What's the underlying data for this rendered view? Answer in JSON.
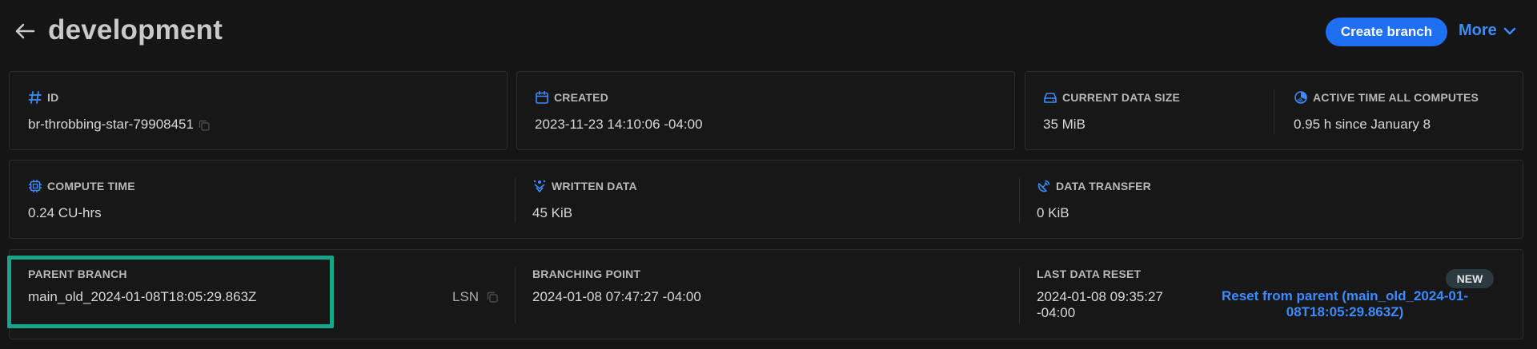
{
  "header": {
    "title": "development",
    "create_label": "Create branch",
    "more_label": "More"
  },
  "row1": {
    "id": {
      "label": "ID",
      "value": "br-throbbing-star-79908451"
    },
    "created": {
      "label": "CREATED",
      "value": "2023-11-23 14:10:06 -04:00"
    },
    "data_size": {
      "label": "CURRENT DATA SIZE",
      "value": "35 MiB"
    },
    "active_time": {
      "label": "ACTIVE TIME ALL COMPUTES",
      "value": "0.95 h since January 8"
    }
  },
  "row2": {
    "compute_time": {
      "label": "COMPUTE TIME",
      "value": "0.24 CU-hrs"
    },
    "written_data": {
      "label": "WRITTEN DATA",
      "value": "45 KiB"
    },
    "data_transfer": {
      "label": "DATA TRANSFER",
      "value": "0 KiB"
    }
  },
  "row3": {
    "parent_branch": {
      "label": "PARENT BRANCH",
      "value": "main_old_2024-01-08T18:05:29.863Z",
      "lsn_label": "LSN"
    },
    "branching_point": {
      "label": "BRANCHING POINT",
      "value": "2024-01-08 07:47:27 -04:00"
    },
    "last_reset": {
      "label": "LAST DATA RESET",
      "value_line1": "2024-01-08 09:35:27",
      "value_line2": "-04:00",
      "badge": "NEW",
      "reset_line1": "Reset from parent (main_old_2024-01-",
      "reset_line2": "08T18:05:29.863Z)"
    }
  },
  "colors": {
    "accent": "#3d8bff",
    "button": "#1f6ff2",
    "highlight": "#17a589",
    "icon": "#3d8bff"
  }
}
